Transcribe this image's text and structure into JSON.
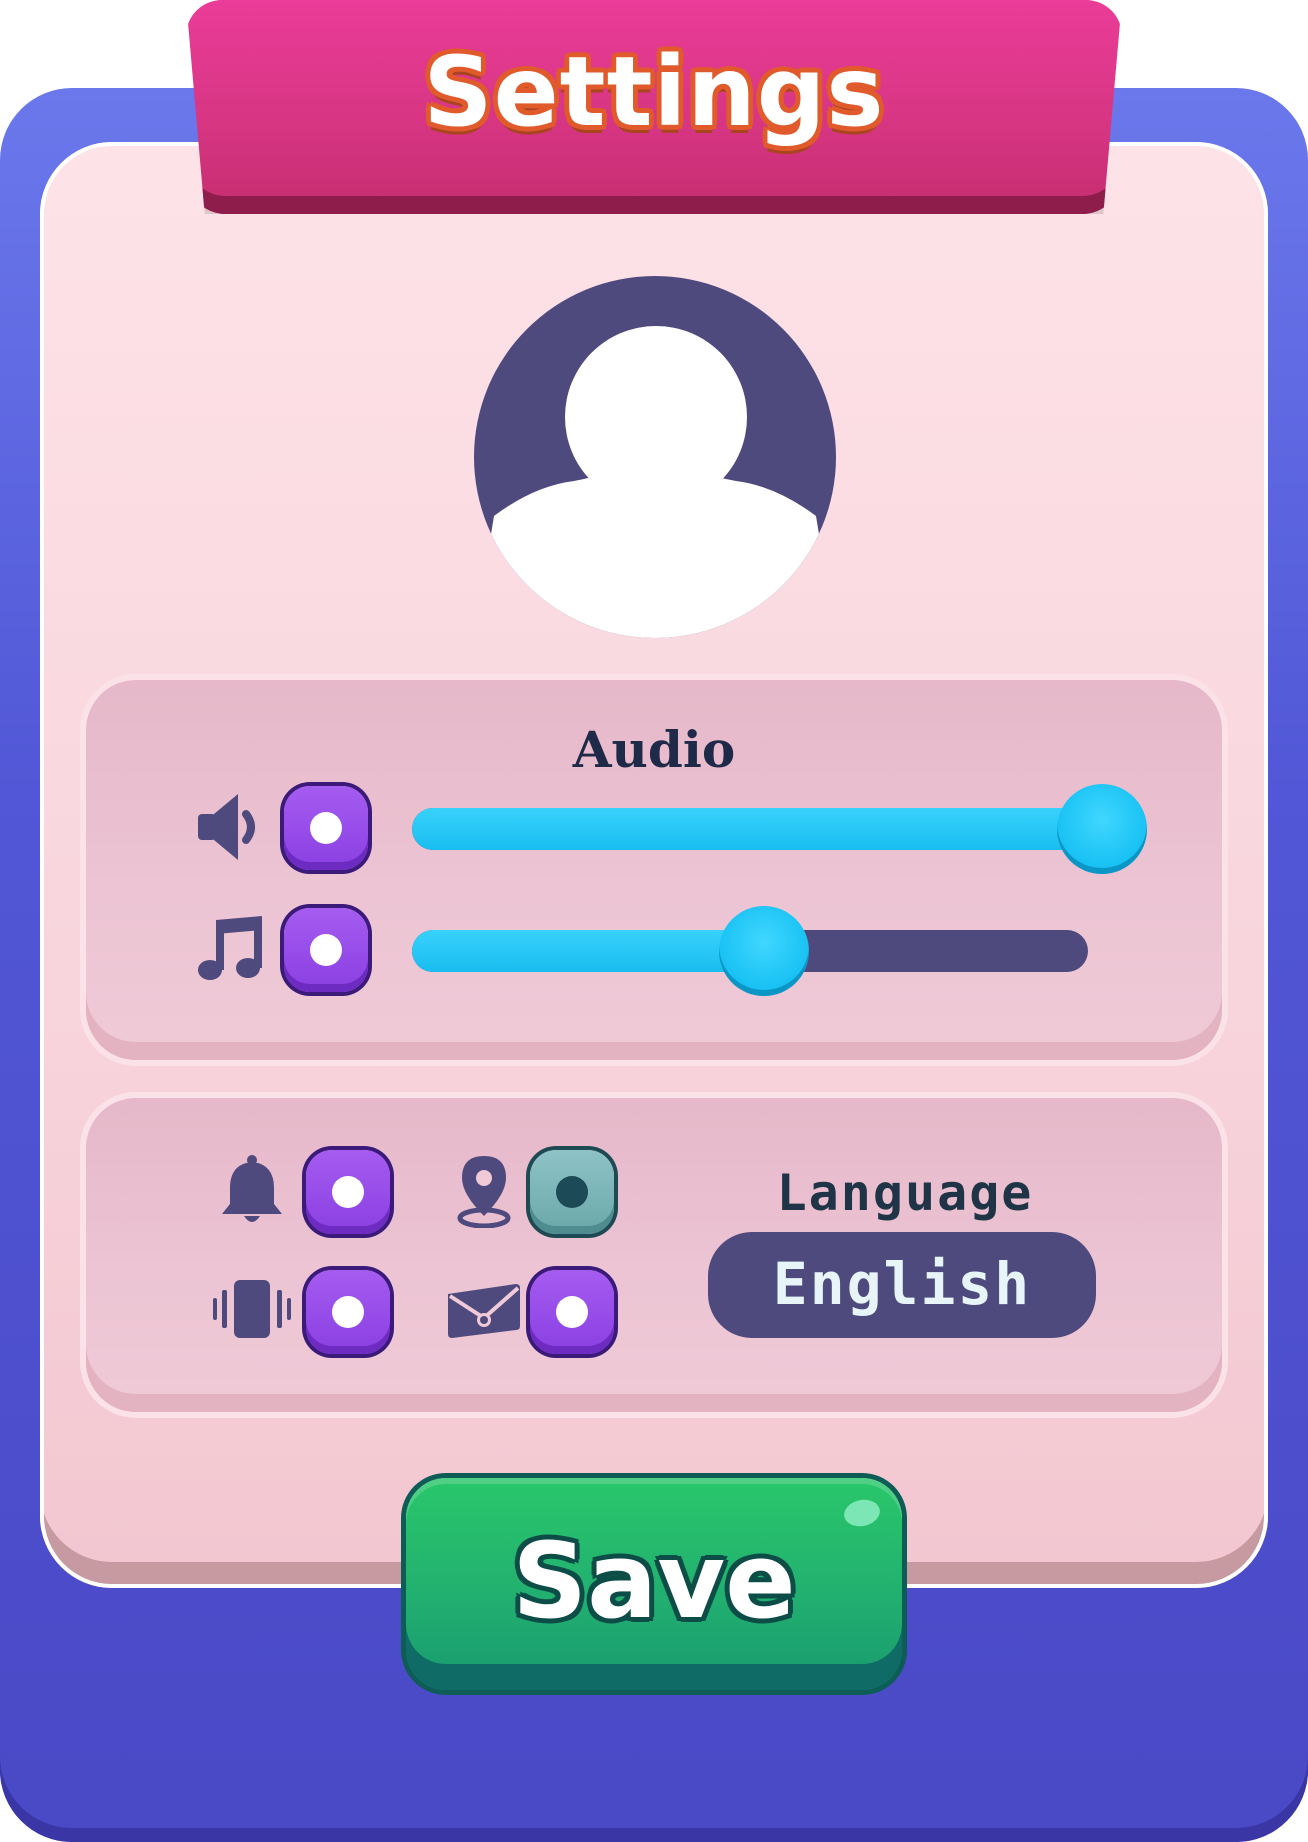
{
  "header": {
    "title": "Settings"
  },
  "avatar": {
    "icon": "user-avatar-icon",
    "color": "#4f4a7e"
  },
  "audio": {
    "section_label": "Audio",
    "sound": {
      "icon": "speaker-icon",
      "enabled": true,
      "level": 0.98
    },
    "music": {
      "icon": "music-note-icon",
      "enabled": true,
      "level": 0.52
    }
  },
  "toggles": [
    {
      "icon": "bell-icon",
      "enabled": true
    },
    {
      "icon": "location-pin-icon",
      "enabled": false
    },
    {
      "icon": "vibration-icon",
      "enabled": true
    },
    {
      "icon": "mail-icon",
      "enabled": true
    }
  ],
  "language": {
    "label": "Language",
    "value": "English"
  },
  "actions": {
    "save_label": "Save"
  },
  "colors": {
    "frame": "#5157d6",
    "card": "#fde3e8",
    "banner": "#d63582",
    "toggle_on": "#8a3fe2",
    "toggle_off": "#6aa7aa",
    "slider_fill": "#19bdf0",
    "slider_track": "#4f4a7e",
    "save": "#22b070"
  }
}
